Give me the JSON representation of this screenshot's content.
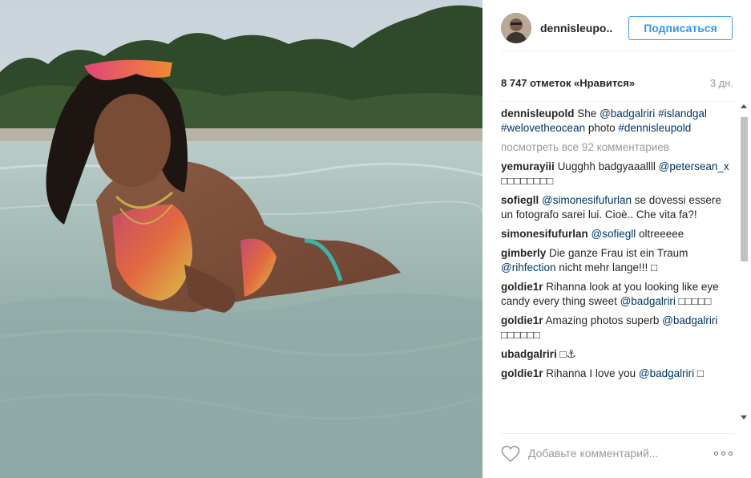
{
  "photo": {
    "alt": ""
  },
  "header": {
    "username": "dennisleupo..",
    "follow_label": "Подписаться"
  },
  "likes_count": "8 747 отметок «Нравится»",
  "time_ago": "3 дн.",
  "caption": {
    "author": "dennisleupold",
    "parts": [
      {
        "text": "She ",
        "link": false
      },
      {
        "text": "@badgalriri",
        "link": true
      },
      {
        "text": " ",
        "link": false
      },
      {
        "text": "#islandgal",
        "link": true
      },
      {
        "text": " ",
        "link": false
      },
      {
        "text": "#welovetheocean",
        "link": true
      },
      {
        "text": " photo ",
        "link": false
      },
      {
        "text": "#dennisleupold",
        "link": true
      }
    ]
  },
  "view_all": "посмотреть все 92 комментариев",
  "comments": [
    {
      "author": "yemurayiii",
      "parts": [
        {
          "text": "Uugghh badgyaaallll ",
          "link": false
        },
        {
          "text": "@petersean_x",
          "link": true
        },
        {
          "text": " □□□□□□□□",
          "link": false
        }
      ]
    },
    {
      "author": "sofiegll",
      "parts": [
        {
          "text": "@simonesifufurlan",
          "link": true
        },
        {
          "text": " se dovessi essere un fotografo sarei lui. Cioè.. Che vita fa?!",
          "link": false
        }
      ]
    },
    {
      "author": "simonesifufurlan",
      "parts": [
        {
          "text": "@sofiegll",
          "link": true
        },
        {
          "text": " oltreeeee",
          "link": false
        }
      ]
    },
    {
      "author": "gimberly",
      "parts": [
        {
          "text": "Die ganze Frau ist ein Traum ",
          "link": false
        },
        {
          "text": "@rihfection",
          "link": true
        },
        {
          "text": " nicht mehr lange!!! □",
          "link": false
        }
      ]
    },
    {
      "author": "goldie1r",
      "parts": [
        {
          "text": "Rihanna look at you looking like eye candy every thing sweet ",
          "link": false
        },
        {
          "text": "@badgalriri",
          "link": true
        },
        {
          "text": " □□□□□",
          "link": false
        }
      ]
    },
    {
      "author": "goldie1r",
      "parts": [
        {
          "text": "Amazing photos superb ",
          "link": false
        },
        {
          "text": "@badgalriri",
          "link": true
        },
        {
          "text": " □□□□□□",
          "link": false
        }
      ]
    },
    {
      "author": "ubadgalriri",
      "parts": [
        {
          "text": "□⚓",
          "link": false
        }
      ]
    },
    {
      "author": "goldie1r",
      "parts": [
        {
          "text": "Rihanna I love you ",
          "link": false
        },
        {
          "text": "@badgalriri",
          "link": true
        },
        {
          "text": " □",
          "link": false
        }
      ]
    }
  ],
  "footer": {
    "like_icon": "heart-icon",
    "comment_placeholder": "Добавьте комментарий...",
    "more_icon": "more-options-icon"
  },
  "colors": {
    "accent": "#3897f0",
    "link": "#003569",
    "muted": "#999999",
    "text": "#262626"
  }
}
